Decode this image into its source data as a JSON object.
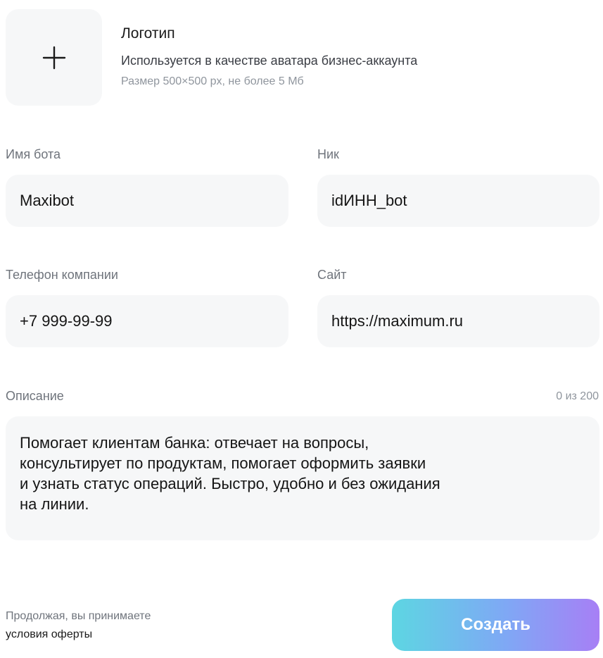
{
  "logo": {
    "icon": "plus-icon",
    "title": "Логотип",
    "description": "Используется в качестве аватара бизнес-аккаунта",
    "size_hint": "Размер 500×500 px, не более 5 Мб"
  },
  "fields": {
    "bot_name": {
      "label": "Имя бота",
      "value": "Maxibot"
    },
    "nick": {
      "label": "Ник",
      "value": "idИНН_bot"
    },
    "phone": {
      "label": "Телефон компании",
      "value": "+7 999-99-99"
    },
    "site": {
      "label": "Сайт",
      "value": "https://maximum.ru"
    }
  },
  "description": {
    "label": "Описание",
    "counter": "0 из 200",
    "lines": [
      "Помогает клиентам банка: отвечает на вопросы,",
      "консультирует по продуктам, помогает оформить заявки",
      "и узнать статус операций. Быстро, удобно и без ожидания",
      "на линии."
    ]
  },
  "footer": {
    "consent_text": "Продолжая, вы принимаете",
    "consent_link": "условия оферты",
    "create_label": "Создать"
  },
  "colors": {
    "field_bg": "#f6f7f8",
    "label": "#6f747c",
    "hint": "#8f959d",
    "button_gradient": [
      "#5dd6e2",
      "#7fa8f5",
      "#a77ff5"
    ]
  }
}
